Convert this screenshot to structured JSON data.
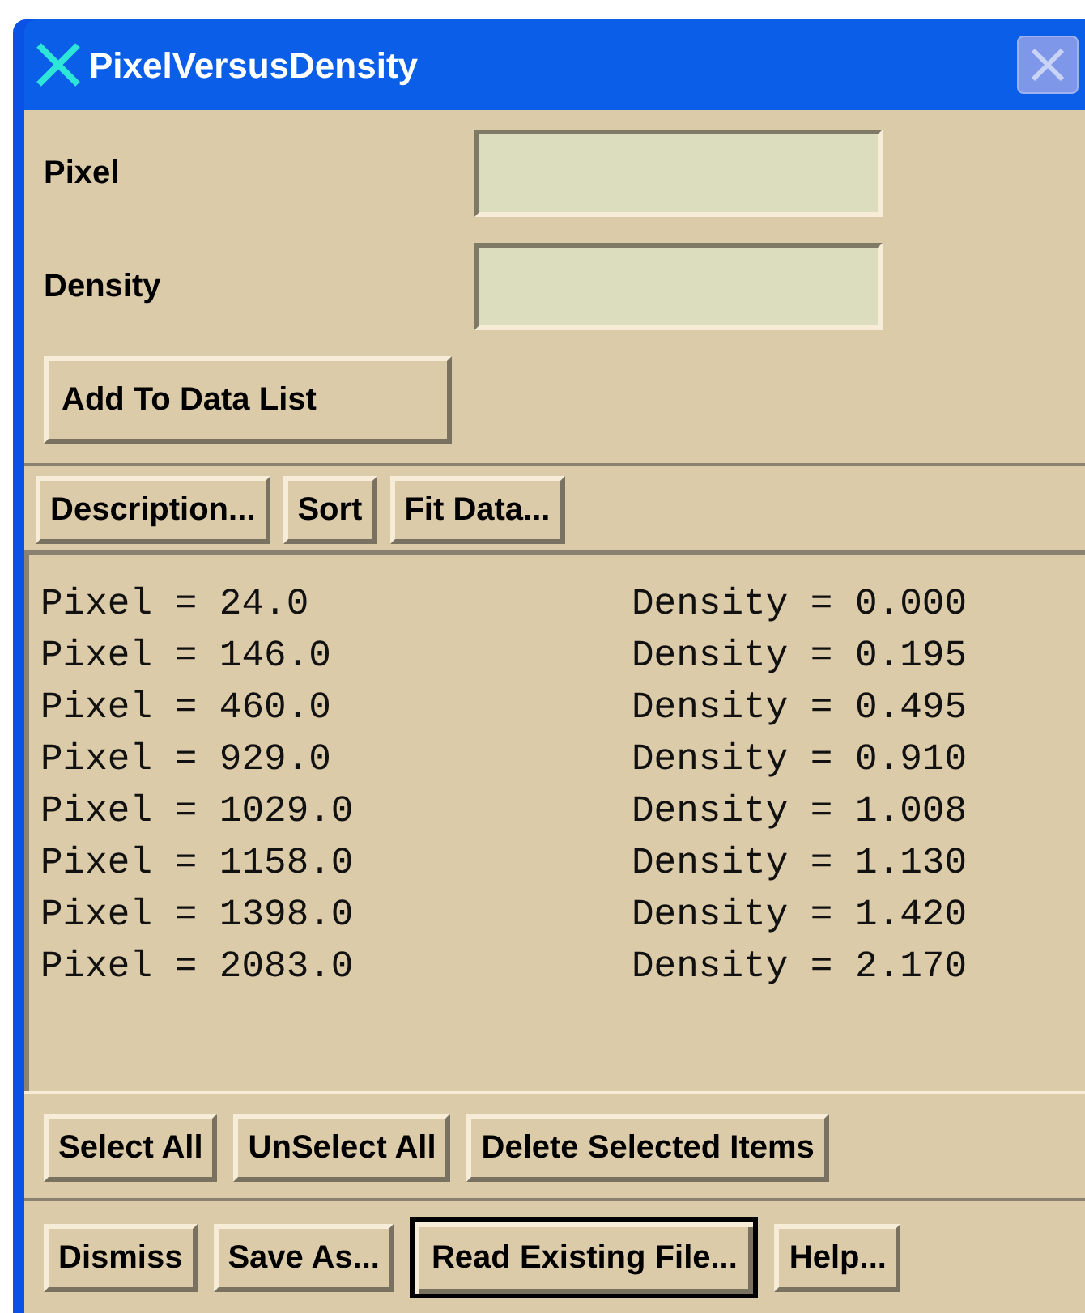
{
  "window": {
    "title": "PixelVersusDensity"
  },
  "fields": [
    {
      "label": "Pixel"
    },
    {
      "label": "Density"
    }
  ],
  "add_button": "Add To Data List",
  "list_buttons": [
    "Description...",
    "Sort",
    "Fit Data..."
  ],
  "list": [
    {
      "pixel": "Pixel = 24.0",
      "density": "Density = 0.000"
    },
    {
      "pixel": "Pixel = 146.0",
      "density": "Density = 0.195"
    },
    {
      "pixel": "Pixel = 460.0",
      "density": "Density = 0.495"
    },
    {
      "pixel": "Pixel = 929.0",
      "density": "Density = 0.910"
    },
    {
      "pixel": "Pixel = 1029.0",
      "density": "Density = 1.008"
    },
    {
      "pixel": "Pixel = 1158.0",
      "density": "Density = 1.130"
    },
    {
      "pixel": "Pixel = 1398.0",
      "density": "Density = 1.420"
    },
    {
      "pixel": "Pixel = 2083.0",
      "density": "Density = 2.170"
    }
  ],
  "selection_buttons": [
    "Select All",
    "UnSelect All",
    "Delete Selected Items"
  ],
  "bottom_buttons": [
    {
      "label": "Dismiss",
      "default": false
    },
    {
      "label": "Save As...",
      "default": false
    },
    {
      "label": "Read Existing File...",
      "default": true
    },
    {
      "label": "Help...",
      "default": false
    }
  ]
}
